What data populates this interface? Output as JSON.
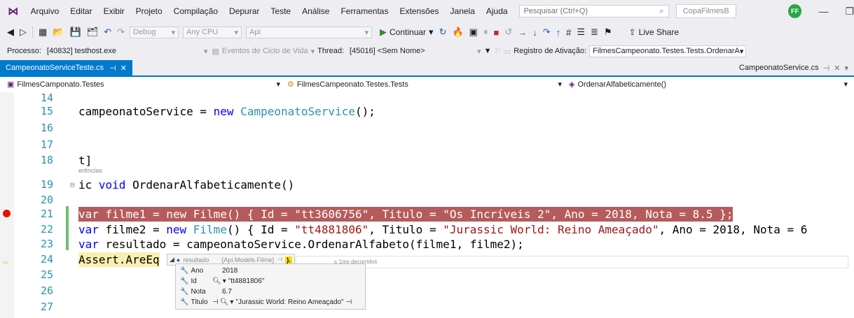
{
  "menubar": {
    "items": [
      "Arquivo",
      "Editar",
      "Exibir",
      "Projeto",
      "Compilação",
      "Depurar",
      "Teste",
      "Análise",
      "Ferramentas",
      "Extensões",
      "Janela",
      "Ajuda"
    ],
    "search_placeholder": "Pesquisar (Ctrl+Q)",
    "solution_name": "CopaFilmesB",
    "avatar_initials": "FF"
  },
  "toolbar": {
    "config": "Debug",
    "platform": "Any CPU",
    "project": "Api",
    "continue_label": "Continuar",
    "live_share": "Live Share"
  },
  "debug_location": {
    "process_label": "Processo:",
    "process_value": "[40832] testhost.exe",
    "lifecycle_label": "Eventos de Ciclo de Vida",
    "thread_label": "Thread:",
    "thread_value": "[45016] <Sem Nome>",
    "stack_label": "Registro de Ativação:",
    "stack_value": "FilmesCampeonato.Testes.Tests.OrdenarA"
  },
  "tabs": {
    "active": "CampeonatoServiceTeste.cs",
    "other": "CampeonatoService.cs"
  },
  "navbar": {
    "project": "FilmesCamponato.Testes",
    "class": "FilmesCampeonato.Testes.Tests",
    "member": "OrdenarAlfabeticamente()"
  },
  "editor": {
    "line_numbers": [
      "14",
      "15",
      "16",
      "17",
      "18",
      "19",
      "20",
      "21",
      "22",
      "23",
      "24",
      "25",
      "26",
      "27"
    ],
    "refs_hint": "erências",
    "line15": [
      "campeonatoService = ",
      "new",
      " ",
      "CampeonatoService",
      "();"
    ],
    "line18": [
      "t]"
    ],
    "line19": [
      "ic ",
      "void",
      " OrdenarAlfabeticamente()"
    ],
    "line21": [
      "var",
      " filme1 = ",
      "new",
      " ",
      "Filme",
      "() { Id = ",
      "\"tt3606756\"",
      ", Titulo = ",
      "\"Os Incríveis 2\"",
      ", Ano = 2018, Nota = 8.5 };"
    ],
    "line22": [
      "var",
      " filme2 = ",
      "new",
      " ",
      "Filme",
      "() { Id = ",
      "\"tt4881806\"",
      ", Titulo = ",
      "\"Jurassic World: Reino Ameaçado\"",
      ", Ano = 2018, Nota = 6"
    ],
    "line23": [
      "var",
      " resultado = campeonatoService.OrdenarAlfabeto(filme1, filme2);"
    ],
    "line24": [
      "Assert.AreEq"
    ]
  },
  "datatip": {
    "var_name": "resultado",
    "var_type": "{Api.Models.Filme}",
    "elapsed": "≤ 1ms decorridos",
    "props": [
      {
        "name": "Ano",
        "value": "2018"
      },
      {
        "name": "Id",
        "value": "\"tt4881806\""
      },
      {
        "name": "Nota",
        "value": "6.7"
      },
      {
        "name": "Titulo",
        "value": "\"Jurassic World: Reino Ameaçado\""
      }
    ]
  }
}
